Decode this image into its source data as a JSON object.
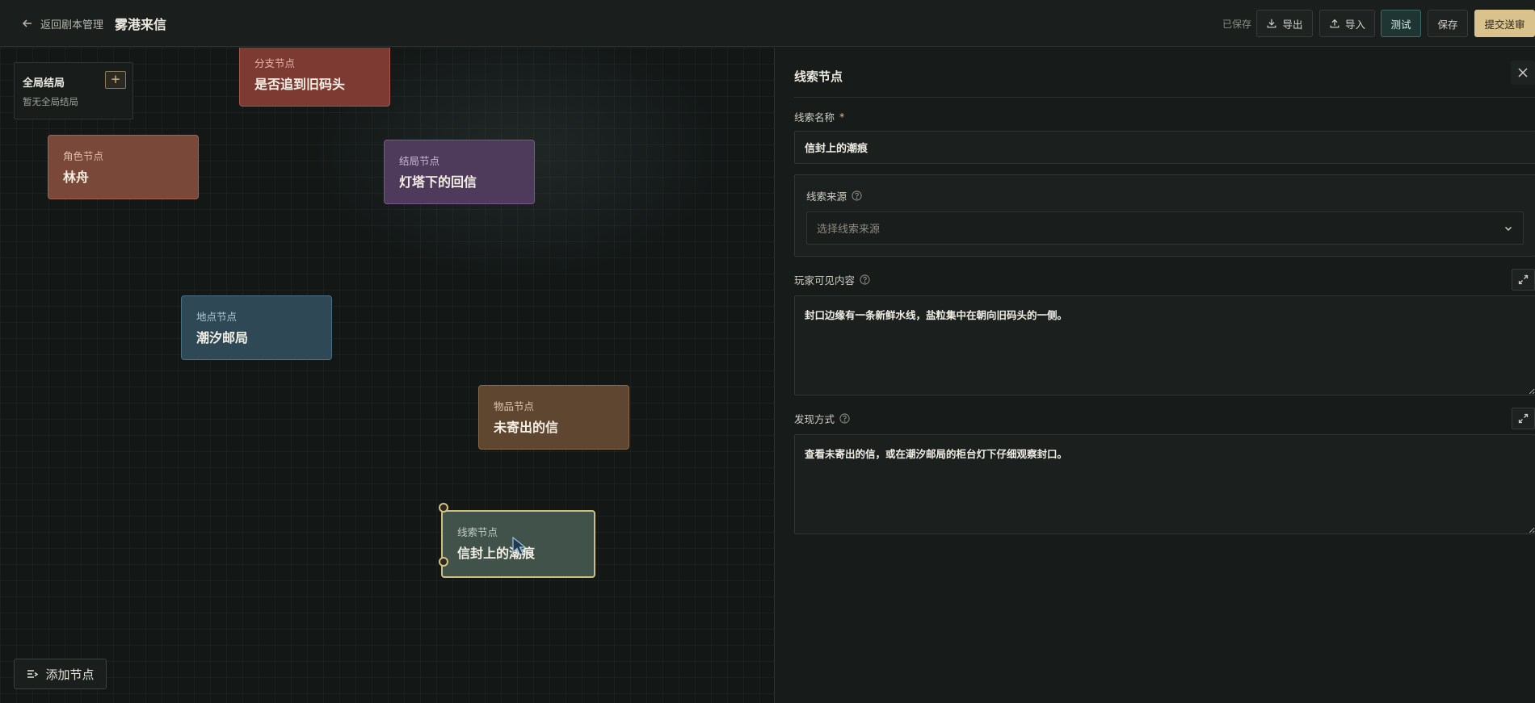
{
  "topbar": {
    "back_label": "返回剧本管理",
    "title": "雾港来信",
    "saved_status": "已保存",
    "export_label": "导出",
    "import_label": "导入",
    "test_label": "测试",
    "save_label": "保存",
    "submit_label": "提交送审"
  },
  "canvas": {
    "global_endings": {
      "title": "全局结局",
      "add_label": "+",
      "empty_text": "暂无全局结局"
    },
    "nodes": {
      "branch": {
        "type": "分支节点",
        "name": "是否追到旧码头"
      },
      "role": {
        "type": "角色节点",
        "name": "林舟"
      },
      "ending": {
        "type": "结局节点",
        "name": "灯塔下的回信"
      },
      "location": {
        "type": "地点节点",
        "name": "潮汐邮局"
      },
      "item": {
        "type": "物品节点",
        "name": "未寄出的信"
      },
      "clue": {
        "type": "线索节点",
        "name": "信封上的潮痕"
      }
    },
    "add_node_label": "添加节点"
  },
  "panel": {
    "title": "线索节点",
    "name_label": "线索名称",
    "required_mark": "*",
    "name_value": "信封上的潮痕",
    "source_label": "线索来源",
    "source_placeholder": "选择线索来源",
    "visible_label": "玩家可见内容",
    "visible_value": "封口边缘有一条新鲜水线，盐粒集中在朝向旧码头的一侧。",
    "discovery_label": "发现方式",
    "discovery_value": "查看未寄出的信，或在潮汐邮局的柜台灯下仔细观察封口。"
  },
  "colors": {
    "accent_gold": "#d9c28c",
    "test_teal": "#1f3533",
    "background": "#151a19"
  },
  "icons": [
    "arrow-left-icon",
    "download-icon",
    "upload-icon",
    "plus-icon",
    "close-icon",
    "help-circle-icon",
    "chevron-down-icon",
    "expand-icon",
    "list-add-icon",
    "cursor-icon"
  ]
}
